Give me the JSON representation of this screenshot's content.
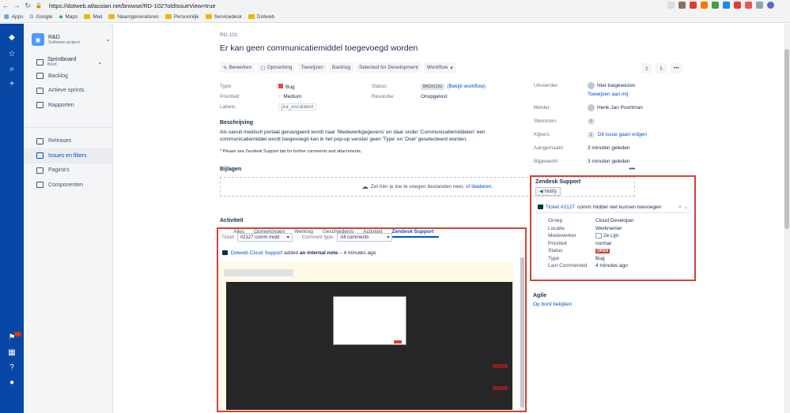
{
  "browser": {
    "url": "https://dotweb.atlassian.net/browse/RD-102?oldIssueView=true",
    "bookmarks": [
      "Apps",
      "Google",
      "Maps",
      "Mail",
      "Naamgeneratoren",
      "Persoonlijk",
      "Servicedesk",
      "Dotweb"
    ]
  },
  "sidebar": {
    "project_name": "R&D",
    "project_type": "Software project",
    "board_name": "Sprintboard",
    "board_sub": "Bord",
    "items": [
      {
        "label": "Backlog"
      },
      {
        "label": "Actieve sprints"
      },
      {
        "label": "Rapporten"
      },
      {
        "label": "Releases"
      },
      {
        "label": "Issues en filters"
      },
      {
        "label": "Pagina's"
      },
      {
        "label": "Componenten"
      }
    ]
  },
  "issue": {
    "key": "RD-102",
    "title": "Er kan geen communicatiemiddel toegevoegd worden",
    "actions": [
      "Bewerken",
      "Opmerking",
      "Toewijzen",
      "Backlog",
      "Selected for Development",
      "Workflow"
    ],
    "details": {
      "type_label": "Type:",
      "type_value": "Bug",
      "status_label": "Status:",
      "status_badge": "BACKLOG",
      "status_link": "(Bekijk workflow)",
      "priority_label": "Prioriteit:",
      "priority_value": "Medium",
      "resolution_label": "Resolutie:",
      "resolution_value": "Onopgelost",
      "labels_label": "Labels:",
      "labels_value": "jira_escalated"
    },
    "description_heading": "Beschrijving",
    "description": "Als vanuit medisch portaal genavigeerd wordt naar 'Medewerkgegevens' en daar onder 'Communicatiemiddelen' een communicatiemiddel wordt toegevoegd kan ik het pop-up venster geen 'Type' en 'Doel' geselecteerd worden.",
    "description_note": "* Please see Zendesk Support tab for further comments and attachments.",
    "attachments_heading": "Bijlagen",
    "dropzone_text": "Zet hier je toe te voegen bestanden neer, of",
    "dropzone_link": "bladeren.",
    "activity_heading": "Activiteit",
    "activity_tabs": [
      "Alles",
      "Opmerkingen",
      "Werklog",
      "Geschiedenis",
      "Activiteit",
      "Zendesk Support"
    ]
  },
  "zendesk_tab": {
    "ticket_label": "Ticket",
    "ticket_select": "#2127 comm midd",
    "comment_type_label": "Comment type:",
    "comment_type_select": "All comments",
    "author": "Dotweb Cloud Support",
    "action": "added",
    "note_type": "an internal note",
    "time": "– 4 minutes ago"
  },
  "people": {
    "assignee_label": "Uitvoerder:",
    "assignee_value": "Niet toegewezen",
    "assign_me": "Toewijzen aan mij",
    "reporter_label": "Melder:",
    "reporter_value": "Henk-Jan Poortman",
    "votes_label": "Stemmen:",
    "votes_value": "0",
    "watchers_label": "Kijkers:",
    "watchers_count": "1",
    "watchers_link": "Dit issue gaan volgen",
    "created_label": "Aangemaakt:",
    "created_value": "3 minuten geleden",
    "updated_label": "Bijgewerkt:",
    "updated_value": "3 minuten geleden"
  },
  "zendesk_panel": {
    "heading": "Zendesk Support",
    "notify": "Notify",
    "ticket_link": "Ticket #2127",
    "ticket_subject": "comm middel niet kunnen toevoegen",
    "rows": [
      {
        "k": "Groep",
        "v": "Cloud Developer"
      },
      {
        "k": "Locatie",
        "v": "Werknemer"
      },
      {
        "k": "Medewerker",
        "v": "2e Lijn"
      },
      {
        "k": "Prioriteit",
        "v": "normal"
      },
      {
        "k": "Status",
        "v": "OPEN"
      },
      {
        "k": "Type",
        "v": "Bug"
      },
      {
        "k": "Last Commented",
        "v": "4 minutes ago"
      }
    ]
  },
  "agile": {
    "heading": "Agile",
    "link": "Op bord bekijken"
  },
  "colors": {
    "nav": "#0747a6",
    "link": "#0052cc",
    "highlight": "#d04437"
  }
}
